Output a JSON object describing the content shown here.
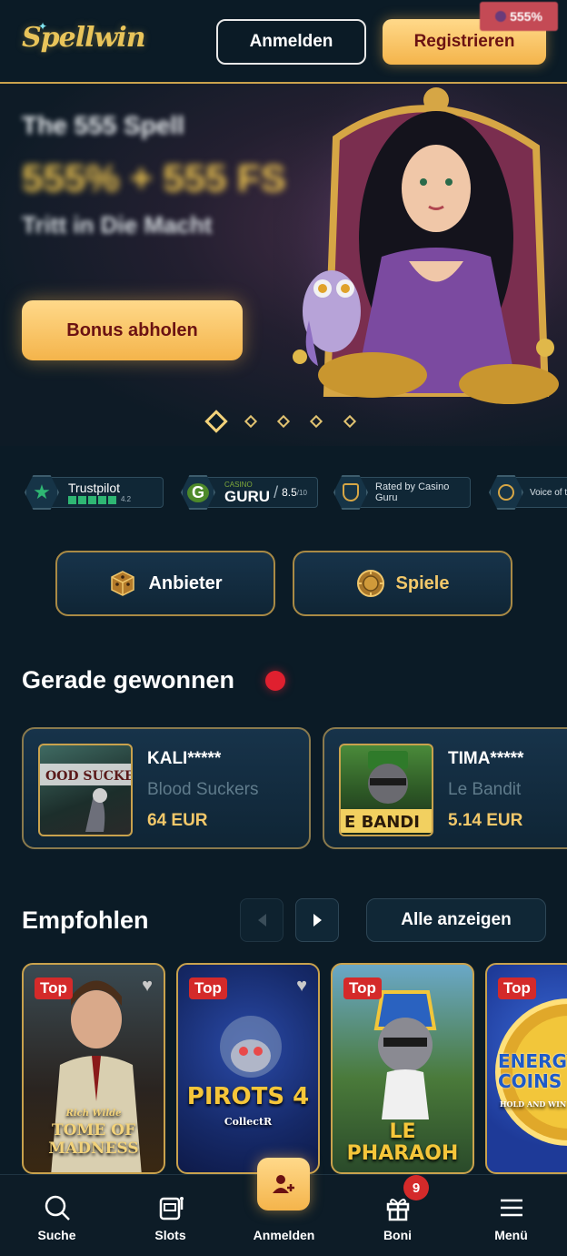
{
  "header": {
    "logo": "Spellwin",
    "login_label": "Anmelden",
    "register_label": "Registrieren",
    "promo_badge": "555%"
  },
  "hero": {
    "title": "The 555 Spell",
    "amount": "555% + 555 FS",
    "subtitle": "Tritt in Die Macht",
    "cta_label": "Bonus abholen",
    "slide_count": 5,
    "active_slide": 1
  },
  "trust": {
    "trustpilot": "Trustpilot",
    "trustpilot_score": "4.2",
    "casino_guru_top": "CASINO",
    "casino_guru": "GURU",
    "casino_guru_score": "8.5",
    "casino_guru_suffix": "/10",
    "rated_by": "Rated by Casino Guru",
    "voice_of": "Voice of the"
  },
  "categories": {
    "providers_label": "Anbieter",
    "games_label": "Spiele"
  },
  "recent_wins": {
    "title": "Gerade gewonnen",
    "items": [
      {
        "user": "KALI*****",
        "game": "Blood Suckers",
        "amount": "64 EUR"
      },
      {
        "user": "TIMA*****",
        "game": "Le Bandit",
        "amount": "5.14 EUR"
      }
    ]
  },
  "recommended": {
    "title": "Empfohlen",
    "show_all_label": "Alle anzeigen",
    "tag": "Top",
    "games": [
      {
        "name": "TOME OF MADNESS",
        "brand": "Rich Wilde"
      },
      {
        "name": "PIROTS 4",
        "brand": "CollectR"
      },
      {
        "name": "LE PHARAOH"
      },
      {
        "name": "ENERGY COINS",
        "brand": "HOLD AND WIN"
      }
    ]
  },
  "bottom_nav": {
    "search": "Suche",
    "slots": "Slots",
    "login": "Anmelden",
    "bonus": "Boni",
    "bonus_count": "9",
    "menu": "Menü"
  },
  "colors": {
    "background": "#0b1b26",
    "gold": "#f4b44b",
    "accent_red": "#d42a2a"
  }
}
